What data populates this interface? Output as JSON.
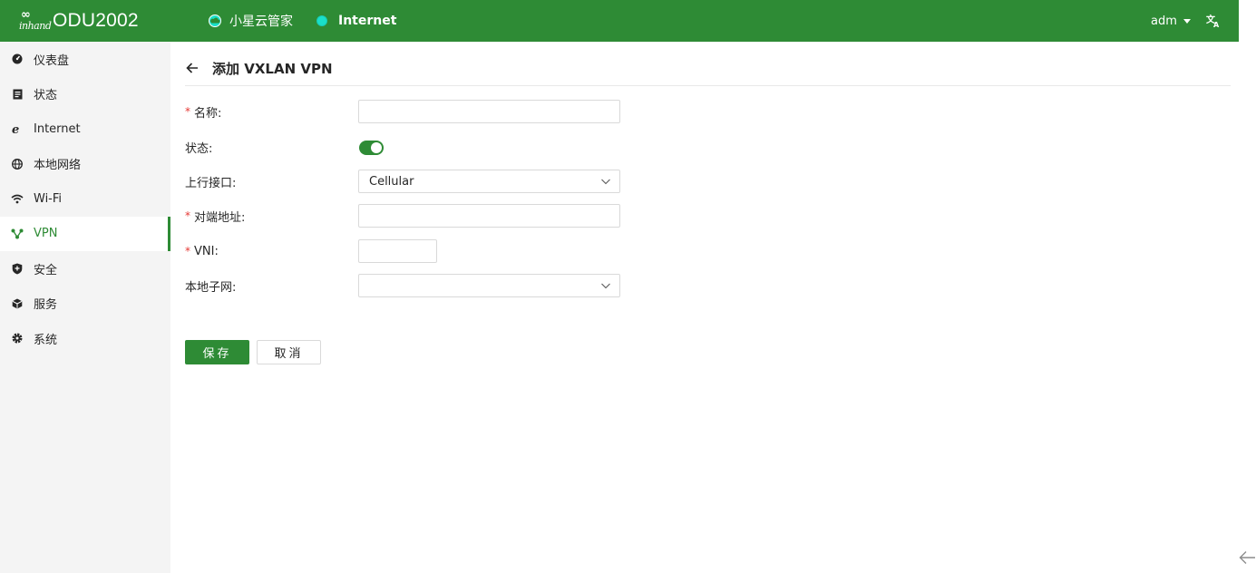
{
  "header": {
    "brand_mark": "∞",
    "brand_sub": "inhand",
    "product_name": "ODU2002",
    "cloud_status_label": "小星云管家",
    "internet_status_label": "Internet",
    "internet_status_color": "#19e0c9",
    "user": "adm",
    "language_icon": "translate-icon",
    "bar_color": "#2e8b35"
  },
  "sidebar": {
    "items": [
      {
        "label": "仪表盘",
        "icon": "dashboard-icon"
      },
      {
        "label": "状态",
        "icon": "status-icon"
      },
      {
        "label": "Internet",
        "icon": "internet-icon"
      },
      {
        "label": "本地网络",
        "icon": "globe-icon"
      },
      {
        "label": "Wi-Fi",
        "icon": "wifi-icon"
      },
      {
        "label": "VPN",
        "icon": "vpn-icon",
        "active": true
      },
      {
        "label": "安全",
        "icon": "shield-icon"
      },
      {
        "label": "服务",
        "icon": "cube-icon"
      },
      {
        "label": "系统",
        "icon": "gear-icon"
      }
    ]
  },
  "page": {
    "title": "添加 VXLAN VPN"
  },
  "form": {
    "required_mark": "*",
    "name_label": "名称:",
    "name_value": "",
    "status_label": "状态:",
    "status_enabled": true,
    "uplink_label": "上行接口:",
    "uplink_value": "Cellular",
    "peer_label": "对端地址:",
    "peer_value": "",
    "vni_label": "VNI:",
    "vni_value": "",
    "subnet_label": "本地子网:",
    "subnet_value": ""
  },
  "actions": {
    "save_label": "保存",
    "cancel_label": "取消"
  }
}
